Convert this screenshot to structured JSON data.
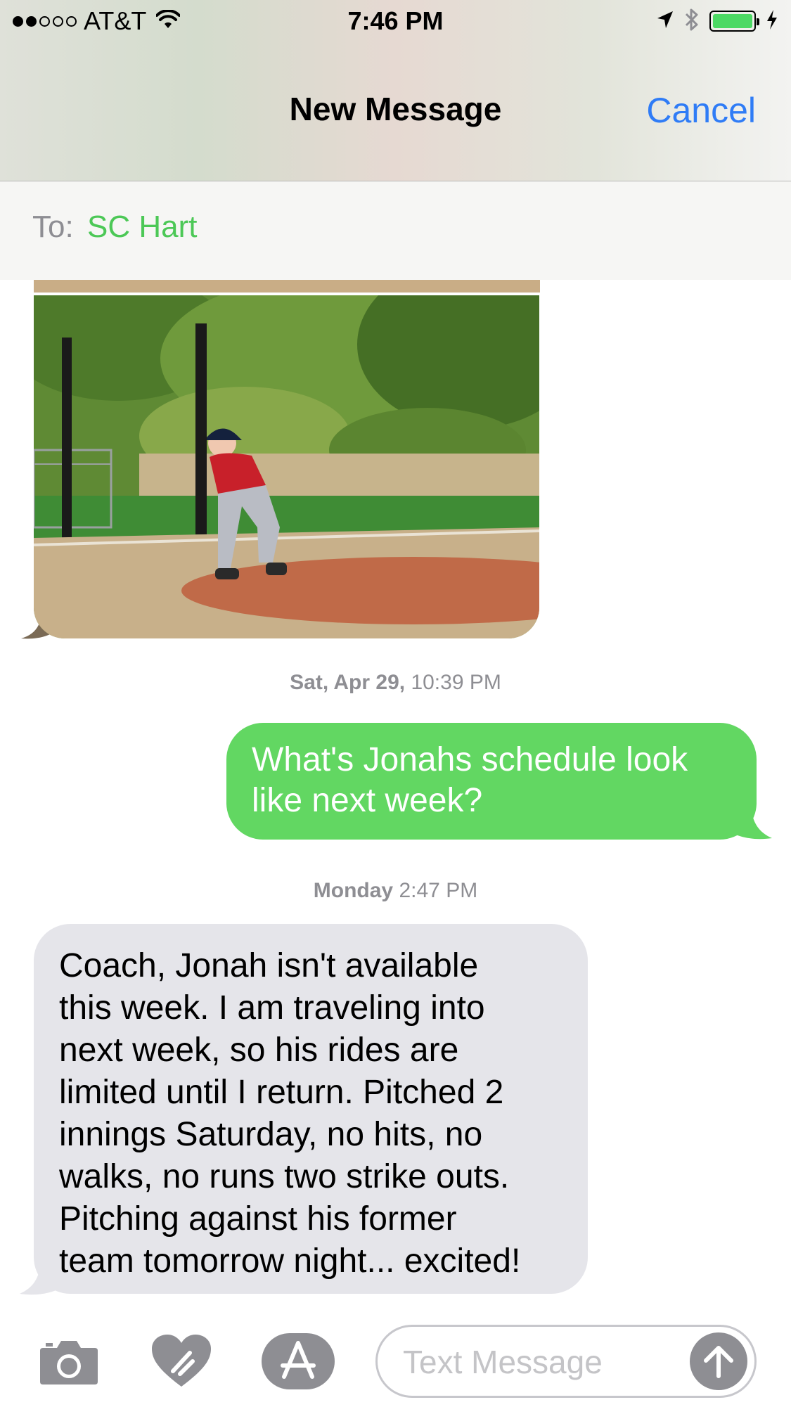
{
  "status_bar": {
    "carrier": "AT&T",
    "time": "7:46 PM",
    "signal_bars_filled": 2,
    "signal_bars_total": 5,
    "battery_level": 1.0,
    "icons": [
      "wifi-icon",
      "location-arrow-icon",
      "bluetooth-icon",
      "battery-icon",
      "charging-bolt-icon"
    ]
  },
  "nav": {
    "title": "New Message",
    "cancel_label": "Cancel"
  },
  "to_field": {
    "label": "To:",
    "recipient": "SC Hart"
  },
  "thread": {
    "photo_message": {
      "direction": "incoming",
      "content": "photo"
    },
    "timestamp_1": {
      "day": "Sat, Apr 29,",
      "time": "10:39 PM"
    },
    "outgoing_message": {
      "text": "What's Jonahs schedule look like next week?"
    },
    "timestamp_2": {
      "day": "Monday",
      "time": "2:47 PM"
    },
    "incoming_message": {
      "text": "Coach, Jonah isn't available\nthis week.  I am traveling into\nnext week, so his rides are\nlimited until I return.  Pitched 2\ninnings Saturday, no hits, no\nwalks, no runs two strike outs.\nPitching against his former\nteam tomorrow night... excited!"
    }
  },
  "input_bar": {
    "placeholder": "Text Message",
    "icons": [
      "camera-icon",
      "digital-touch-heart-icon",
      "app-store-icon",
      "send-arrow-icon"
    ]
  },
  "colors": {
    "outgoing_bubble": "#62d762",
    "incoming_bubble": "#e5e5ea",
    "link_blue": "#2f7cf6",
    "recipient_green": "#4cc856",
    "timestamp_gray": "#8e8e93"
  }
}
